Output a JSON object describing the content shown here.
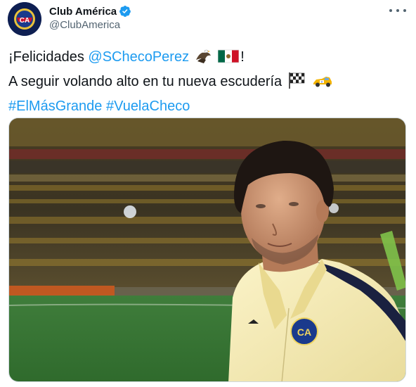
{
  "author": {
    "display_name": "Club América",
    "handle": "@ClubAmerica",
    "verified": true
  },
  "tweet": {
    "line1_prefix": "¡Felicidades ",
    "mention": "@SChecoPerez",
    "line1_suffix": "!",
    "line2": "A seguir volando alto en tu nueva escudería",
    "hashtag1": "#ElMásGrande",
    "hashtag2": "#VuelaCheco"
  },
  "media": {
    "crest_label": "CA"
  },
  "icons": [
    "verified-badge-icon",
    "more-options-icon",
    "eagle-emoji",
    "mexico-flag-emoji",
    "checkered-flag-emoji",
    "race-car-emoji"
  ],
  "colors": {
    "link": "#1d9bf0",
    "verified": "#1d9bf0",
    "secondary_text": "#536471",
    "jacket": "#f5ebb8",
    "stadium_yellow": "#c9a233"
  }
}
